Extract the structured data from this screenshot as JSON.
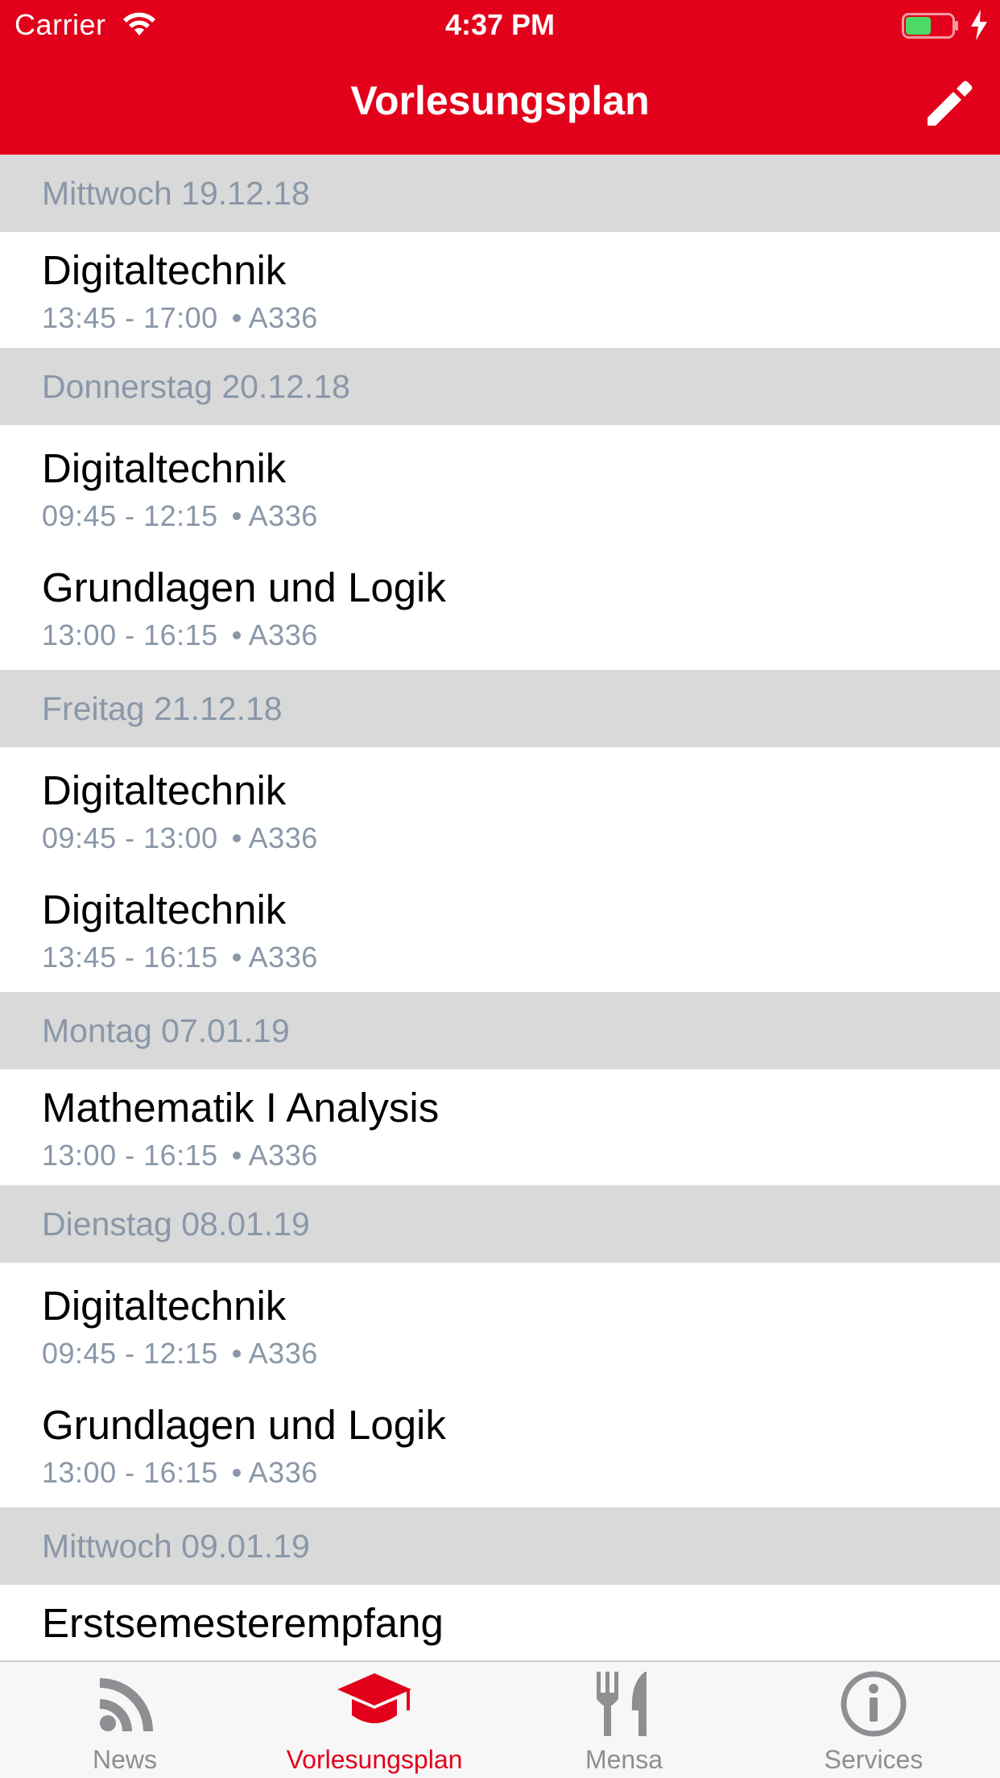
{
  "status_bar": {
    "carrier": "Carrier",
    "time": "4:37 PM"
  },
  "nav": {
    "title": "Vorlesungsplan",
    "edit_icon": "pencil-icon"
  },
  "schedule": [
    {
      "date": "Mittwoch 19.12.18",
      "items": [
        {
          "title": "Digitaltechnik",
          "time": "13:45 - 17:00",
          "room": "A336"
        }
      ]
    },
    {
      "date": "Donnerstag 20.12.18",
      "items": [
        {
          "title": "Digitaltechnik",
          "time": "09:45 - 12:15",
          "room": "A336"
        },
        {
          "title": "Grundlagen und Logik",
          "time": "13:00 - 16:15",
          "room": "A336"
        }
      ]
    },
    {
      "date": "Freitag 21.12.18",
      "items": [
        {
          "title": "Digitaltechnik",
          "time": "09:45 - 13:00",
          "room": "A336"
        },
        {
          "title": "Digitaltechnik",
          "time": "13:45 - 16:15",
          "room": "A336"
        }
      ]
    },
    {
      "date": "Montag 07.01.19",
      "items": [
        {
          "title": "Mathematik I Analysis",
          "time": "13:00 - 16:15",
          "room": "A336"
        }
      ]
    },
    {
      "date": "Dienstag 08.01.19",
      "items": [
        {
          "title": "Digitaltechnik",
          "time": "09:45 - 12:15",
          "room": "A336"
        },
        {
          "title": "Grundlagen und Logik",
          "time": "13:00 - 16:15",
          "room": "A336"
        }
      ]
    },
    {
      "date": "Mittwoch 09.01.19",
      "items": [
        {
          "title": "Erstsemesterempfang",
          "time": "",
          "room": ""
        }
      ]
    }
  ],
  "tabbar": {
    "tabs": [
      {
        "label": "News",
        "icon": "rss-icon",
        "active": false
      },
      {
        "label": "Vorlesungsplan",
        "icon": "graduation-cap-icon",
        "active": true
      },
      {
        "label": "Mensa",
        "icon": "fork-knife-icon",
        "active": false
      },
      {
        "label": "Services",
        "icon": "info-icon",
        "active": false
      }
    ]
  },
  "colors": {
    "brand": "#e2001a",
    "section_bg": "#d9d9d9",
    "secondary_text": "#8a97a8",
    "tab_inactive": "#8e8e93"
  }
}
